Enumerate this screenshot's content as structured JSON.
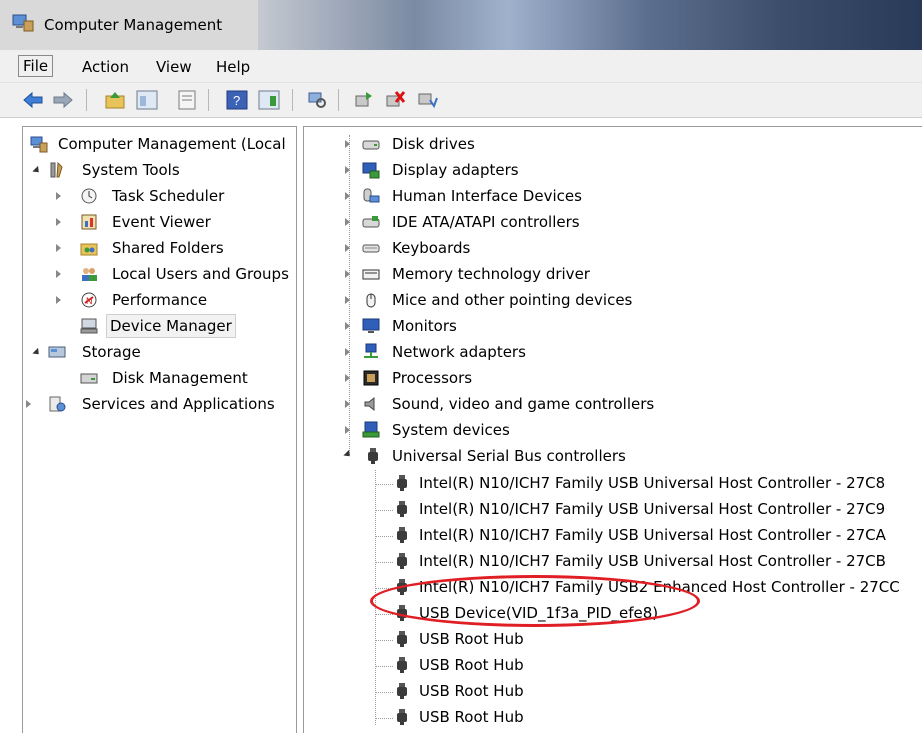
{
  "window": {
    "title": "Computer Management"
  },
  "menu": [
    "File",
    "Action",
    "View",
    "Help"
  ],
  "toolbar": {
    "icons": [
      "back-arrow-icon",
      "forward-arrow-icon",
      "up-folder-icon",
      "show-hide-tree-icon",
      "properties-icon",
      "help-icon",
      "action-pane-icon",
      "scan-hardware-icon",
      "update-driver-icon",
      "uninstall-icon",
      "disable-icon"
    ]
  },
  "left_tree": {
    "root": "Computer Management (Local",
    "system_tools": "System Tools",
    "task_scheduler": "Task Scheduler",
    "event_viewer": "Event Viewer",
    "shared_folders": "Shared Folders",
    "local_users": "Local Users and Groups",
    "performance": "Performance",
    "device_manager": "Device Manager",
    "storage": "Storage",
    "disk_management": "Disk Management",
    "services": "Services and Applications"
  },
  "devices": {
    "categories": [
      "Disk drives",
      "Display adapters",
      "Human Interface Devices",
      "IDE ATA/ATAPI controllers",
      "Keyboards",
      "Memory technology driver",
      "Mice and other pointing devices",
      "Monitors",
      "Network adapters",
      "Processors",
      "Sound, video and game controllers",
      "System devices",
      "Universal Serial Bus controllers"
    ],
    "usb_children": [
      "Intel(R) N10/ICH7 Family USB Universal Host Controller - 27C8",
      "Intel(R) N10/ICH7 Family USB Universal Host Controller - 27C9",
      "Intel(R) N10/ICH7 Family USB Universal Host Controller - 27CA",
      "Intel(R) N10/ICH7 Family USB Universal Host Controller - 27CB",
      "Intel(R) N10/ICH7 Family USB2 Enhanced Host Controller - 27CC",
      "USB Device(VID_1f3a_PID_efe8)",
      "USB Root Hub",
      "USB Root Hub",
      "USB Root Hub",
      "USB Root Hub"
    ]
  },
  "colors": {
    "highlight_ring": "#e01f25",
    "selection": "#f2f2f2"
  }
}
